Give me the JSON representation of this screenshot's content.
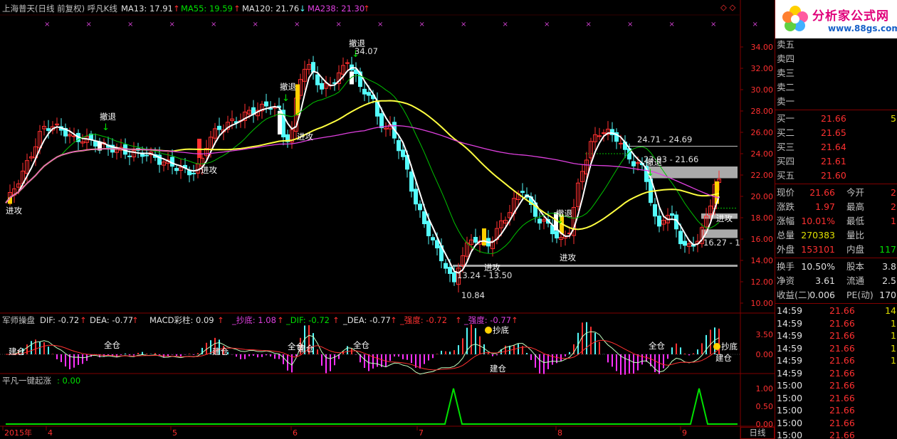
{
  "chart_header": {
    "title": "上海普天(日线 前复权) 呼凡K线",
    "ma13": "MA13: 17.91",
    "ma55": "MA55: 19.59",
    "ma120": "MA120: 21.76",
    "ma238": "MA238: 21.30",
    "ma13_arrow": "↑",
    "ma55_arrow": "↑",
    "ma120_arrow": "↓",
    "ma238_arrow": "↑"
  },
  "main_chart": {
    "y_ticks": [
      "34.00",
      "32.00",
      "30.00",
      "28.00",
      "26.00",
      "24.00",
      "22.00",
      "20.00",
      "18.00",
      "16.00",
      "14.00",
      "12.00",
      "10.00"
    ],
    "annotations": {
      "high_label": "34.07",
      "low_label": "10.84",
      "range_label_1": "13.24 - 13.50",
      "range_label_2": "24.71 - 24.69",
      "range_label_3": "23.93 - 21.66",
      "range_label_4": "16.27 - 1"
    },
    "signals": {
      "attack": "进攻",
      "retreat": "撤退"
    }
  },
  "macd_panel": {
    "title": "军师操盘",
    "dif": "DIF: -0.72",
    "dea": "DEA: -0.77",
    "macd": "MACD彩柱: 0.09",
    "bottom": "_抄底: 1.08",
    "dif2": "_DIF: -0.72",
    "dea2": "_DEA: -0.77",
    "strength": "_强度: -0.72",
    "strength2": "_强度: -0.77",
    "y_ticks": [
      "3.50",
      "0.00"
    ],
    "signal_build": "建仓",
    "signal_full": "全仓",
    "signal_bottom": "抄底"
  },
  "lower_panel": {
    "title": "平凡一键起涨",
    "value": ": 0.00",
    "y_ticks": [
      "1.00",
      "0.50",
      "0.00"
    ]
  },
  "x_axis": {
    "labels": [
      "2015年",
      "4",
      "5",
      "6",
      "7",
      "8",
      "9"
    ],
    "period_tab": "日线"
  },
  "logo": {
    "title": "分析家公式网",
    "url": "www.88gs.com"
  },
  "order_book": {
    "sell": [
      {
        "label": "卖五",
        "price": "",
        "vol": ""
      },
      {
        "label": "卖四",
        "price": "",
        "vol": ""
      },
      {
        "label": "卖三",
        "price": "",
        "vol": ""
      },
      {
        "label": "卖二",
        "price": "",
        "vol": ""
      },
      {
        "label": "卖一",
        "price": "",
        "vol": ""
      }
    ],
    "buy": [
      {
        "label": "买一",
        "price": "21.66",
        "vol": "5"
      },
      {
        "label": "买二",
        "price": "21.65",
        "vol": ""
      },
      {
        "label": "买三",
        "price": "21.64",
        "vol": ""
      },
      {
        "label": "买四",
        "price": "21.61",
        "vol": ""
      },
      {
        "label": "买五",
        "price": "21.60",
        "vol": ""
      }
    ]
  },
  "quote": [
    {
      "l1": "现价",
      "v1": "21.66",
      "l2": "今开",
      "v2": "2",
      "c1": "#ff3030",
      "c2": "#ff3030"
    },
    {
      "l1": "涨跌",
      "v1": "1.97",
      "l2": "最高",
      "v2": "2",
      "c1": "#ff3030",
      "c2": "#ff3030"
    },
    {
      "l1": "涨幅",
      "v1": "10.01%",
      "l2": "最低",
      "v2": "1",
      "c1": "#ff3030",
      "c2": "#ff3030"
    },
    {
      "l1": "总量",
      "v1": "270383",
      "l2": "量比",
      "v2": "",
      "c1": "#e0e000",
      "c2": "#e0e000"
    },
    {
      "l1": "外盘",
      "v1": "153101",
      "l2": "内盘",
      "v2": "117",
      "c1": "#ff3030",
      "c2": "#00e000"
    }
  ],
  "stats": [
    {
      "l1": "换手",
      "v1": "10.50%",
      "l2": "股本",
      "v2": "3.8"
    },
    {
      "l1": "净资",
      "v1": "3.61",
      "l2": "流通",
      "v2": "2.5"
    },
    {
      "l1": "收益(二)",
      "v1": "0.006",
      "l2": "PE(动)",
      "v2": "170"
    }
  ],
  "ticks": [
    {
      "time": "14:59",
      "price": "21.66",
      "vol": "14"
    },
    {
      "time": "14:59",
      "price": "21.66",
      "vol": "1"
    },
    {
      "time": "14:59",
      "price": "21.66",
      "vol": "1"
    },
    {
      "time": "14:59",
      "price": "21.66",
      "vol": "1"
    },
    {
      "time": "14:59",
      "price": "21.66",
      "vol": "1"
    },
    {
      "time": "14:59",
      "price": "21.66",
      "vol": ""
    },
    {
      "time": "15:00",
      "price": "21.66",
      "vol": ""
    },
    {
      "time": "15:00",
      "price": "21.66",
      "vol": ""
    },
    {
      "time": "15:00",
      "price": "21.66",
      "vol": ""
    },
    {
      "time": "15:00",
      "price": "21.66",
      "vol": ""
    },
    {
      "time": "15:00",
      "price": "21.66",
      "vol": ""
    },
    {
      "time": "15:00",
      "price": "21.66",
      "vol": ""
    }
  ],
  "colors": {
    "up": "#ff3030",
    "down": "#54fcfc",
    "ma13": "#ffffff",
    "ma55": "#00c000",
    "ma120": "#ffff40",
    "ma238": "#e040e0",
    "grid": "#800000"
  }
}
